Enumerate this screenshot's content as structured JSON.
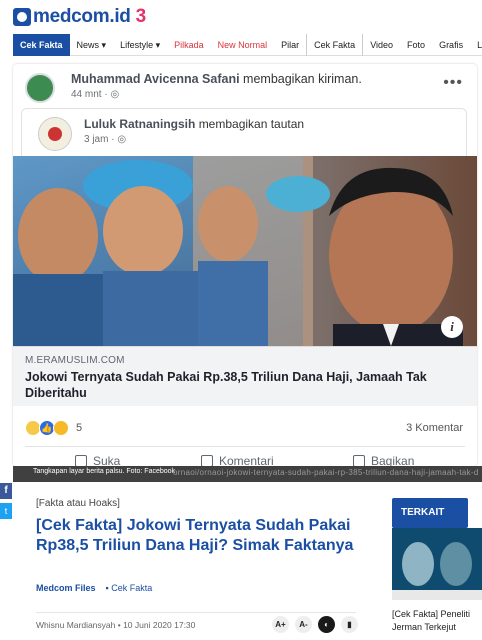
{
  "site": {
    "logo": "medcom.id",
    "logo_suffix": "3"
  },
  "nav": [
    "Cek Fakta",
    "News ▾",
    "Lifestyle ▾",
    "Pilkada",
    "New Normal",
    "Pilar",
    "Cek Fakta",
    "Video",
    "Foto",
    "Grafis",
    "L"
  ],
  "post": {
    "author": "Muhammad Avicenna Safani",
    "action": "membagikan kiriman.",
    "time": "44 mnt · ◎",
    "more": "•••",
    "shared_author": "Luluk Ratnaningsih",
    "shared_action": "membagikan tautan",
    "shared_time": "3 jam · ◎",
    "info_icon": "i",
    "link_domain": "M.ERAMUSLIM.COM",
    "link_title": "Jokowi Ternyata Sudah Pakai Rp.38,5 Triliun Dana Haji, Jamaah Tak Diberitahu",
    "reaction_count": "5",
    "comment_count": "3 Komentar",
    "actions": [
      "Suka",
      "Komentari",
      "Bagikan"
    ]
  },
  "caption": {
    "text": "Tangkapan layar berita palsu. Foto: Facebook",
    "url": "ornaoi/ornaoi-jokowi-ternyata-sudah-pakai-rp-385-triliun-dana-haji-jamaah-tak-d"
  },
  "share": {
    "fb": "f",
    "tw": "t"
  },
  "article": {
    "kicker": "[Fakta atau Hoaks]",
    "headline": "[Cek Fakta] Jokowi Ternyata Sudah Pakai Rp38,5 Triliun Dana Haji? Simak Faktanya",
    "source": "Medcom Files",
    "category": "Cek Fakta",
    "byline": "Whisnu Mardiansyah • 10 Juni 2020 17:30",
    "tools": [
      "A+",
      "A-",
      "◐",
      "▮"
    ]
  },
  "related": {
    "label": "TERKAIT",
    "title": "[Cek Fakta] Peneliti Jerman Terkejut"
  }
}
